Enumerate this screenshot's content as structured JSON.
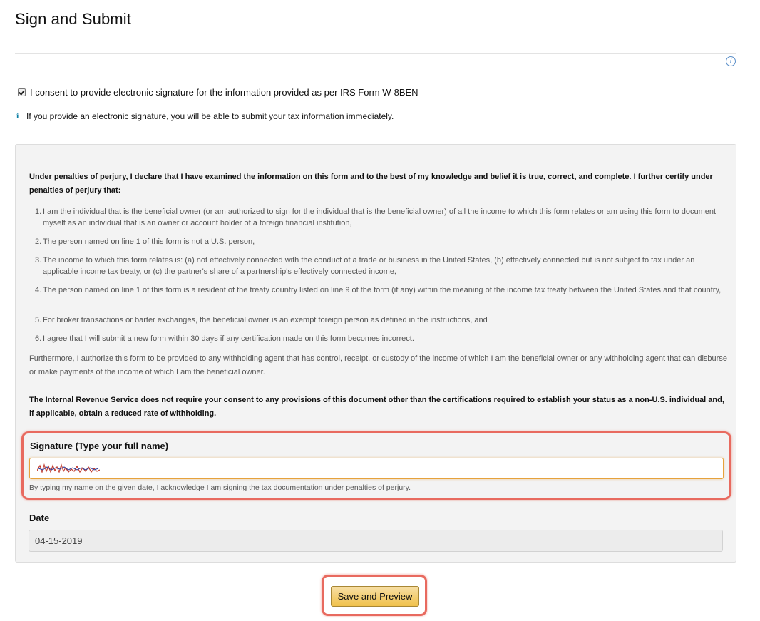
{
  "page": {
    "title": "Sign and Submit",
    "info_glyph": "i"
  },
  "consent": {
    "checked": true,
    "label": "I consent to provide electronic signature for the information provided as per IRS Form W-8BEN"
  },
  "note": {
    "icon": "i",
    "text": "If you provide an electronic signature, you will be able to submit your tax information immediately."
  },
  "certification": {
    "heading": "Under penalties of perjury, I declare that I have examined the information on this form and to the best of my knowledge and belief it is true, correct, and complete. I further certify under penalties of perjury that:",
    "items": [
      {
        "num": "1.",
        "text": "I am the individual that is the beneficial owner (or am authorized to sign for the individual that is the beneficial owner) of all the income to which this form relates or am using this form to document myself as an individual that is an owner or account holder of a foreign financial institution,"
      },
      {
        "num": "2.",
        "text": "The person named on line 1 of this form is not a U.S. person,"
      },
      {
        "num": "3.",
        "text": "The income to which this form relates is: (a) not effectively connected with the conduct of a trade or business in the United States, (b) effectively connected but is not subject to tax under an applicable income tax treaty, or (c) the partner's share of a partnership's effectively connected income,"
      },
      {
        "num": "4.",
        "text": "The person named on line 1 of this form is a resident of the treaty country listed on line 9 of the form (if any) within the meaning of the income tax treaty between the United States and that country,"
      },
      {
        "num": "5.",
        "text": "For broker transactions or barter exchanges, the beneficial owner is an exempt foreign person as defined in the instructions, and"
      },
      {
        "num": "6.",
        "text": "I agree that I will submit a new form within 30 days if any certification made on this form becomes incorrect."
      }
    ],
    "furthermore": "Furthermore, I authorize this form to be provided to any withholding agent that has control, receipt, or custody of the income of which I am the beneficial owner or any withholding agent that can disburse or make payments of the income of which I am the beneficial owner.",
    "irs_note": "The Internal Revenue Service does not require your consent to any provisions of this document other than the certifications required to establish your status as a non-U.S. individual and, if applicable, obtain a reduced rate of withholding."
  },
  "signature": {
    "label": "Signature (Type your full name)",
    "hint": "By typing my name on the given date, I acknowledge I am signing the tax documentation under penalties of perjury."
  },
  "date": {
    "label": "Date",
    "value": "04-15-2019"
  },
  "actions": {
    "save_preview_label": "Save and Preview"
  },
  "colors": {
    "highlight": "#e86a5f",
    "button": "#f0c14b",
    "info_blue": "#0a7ea4"
  }
}
